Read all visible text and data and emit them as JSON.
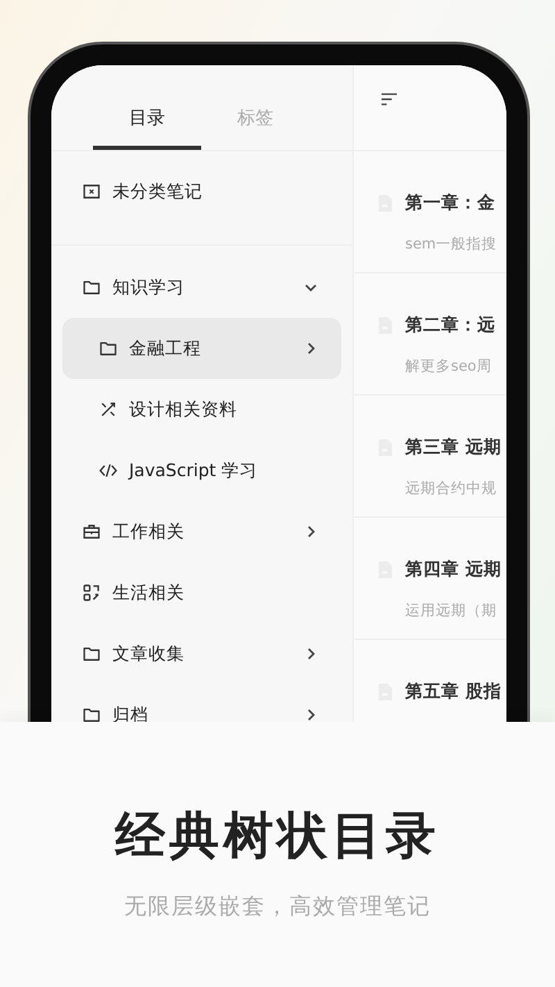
{
  "tabs": [
    {
      "label": "目录",
      "selected": true
    },
    {
      "label": "标签",
      "selected": false
    }
  ],
  "tree": [
    {
      "label": "未分类笔记",
      "kind": "unsorted",
      "selected": false
    },
    {
      "label": "知识学习",
      "kind": "folder",
      "expanded": true,
      "selected": false,
      "children": [
        {
          "label": "金融工程",
          "kind": "folder",
          "expanded": false,
          "selected": true
        },
        {
          "label": "设计相关资料",
          "kind": "design",
          "selected": false
        },
        {
          "label": "JavaScript 学习",
          "kind": "code",
          "selected": false
        }
      ]
    },
    {
      "label": "工作相关",
      "kind": "briefcase",
      "expanded": false,
      "selected": false
    },
    {
      "label": "生活相关",
      "kind": "apps",
      "selected": false
    },
    {
      "label": "文章收集",
      "kind": "folder",
      "expanded": false,
      "selected": false
    },
    {
      "label": "归档",
      "kind": "folder",
      "expanded": false,
      "selected": false
    }
  ],
  "notes": [
    {
      "title": "第一章：金",
      "summary": "sem一般指搜"
    },
    {
      "title": "第二章：远",
      "summary": "解更多seo周"
    },
    {
      "title": "第三章 远期",
      "summary": "远期合约中规"
    },
    {
      "title": "第四章 远期",
      "summary": "运用远期（期"
    },
    {
      "title": "第五章 股指"
    }
  ],
  "caption": {
    "title": "经典树状目录",
    "subtitle": "无限层级嵌套，高效管理笔记"
  }
}
